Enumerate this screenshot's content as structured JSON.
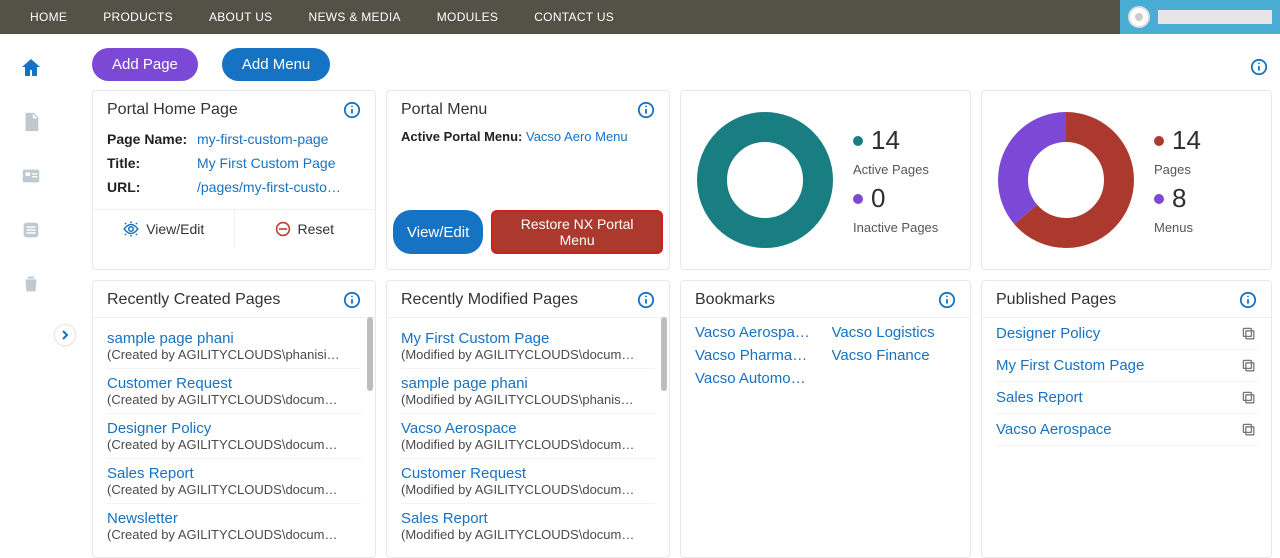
{
  "topnav": [
    "HOME",
    "PRODUCTS",
    "ABOUT US",
    "NEWS & MEDIA",
    "MODULES",
    "CONTACT US"
  ],
  "toolbar": {
    "add_page": "Add Page",
    "add_menu": "Add Menu"
  },
  "portal_home": {
    "title": "Portal Home Page",
    "labels": {
      "page_name": "Page Name:",
      "title": "Title:",
      "url": "URL:"
    },
    "values": {
      "page_name": "my-first-custom-page",
      "title": "My First Custom Page",
      "url": "/pages/my-first-custo…"
    },
    "actions": {
      "view_edit": "View/Edit",
      "reset": "Reset"
    }
  },
  "portal_menu": {
    "title": "Portal Menu",
    "active_label": "Active Portal Menu:",
    "active_value": "Vacso Aero Menu",
    "buttons": {
      "view_edit": "View/Edit",
      "restore": "Restore NX Portal Menu"
    }
  },
  "chart_data": [
    {
      "type": "pie",
      "series": [
        {
          "name": "Active Pages",
          "value": 14,
          "color": "#197e82"
        },
        {
          "name": "Inactive Pages",
          "value": 0,
          "color": "#7c48d6"
        }
      ]
    },
    {
      "type": "pie",
      "series": [
        {
          "name": "Pages",
          "value": 14,
          "color": "#ab392e"
        },
        {
          "name": "Menus",
          "value": 8,
          "color": "#7c48d6"
        }
      ]
    }
  ],
  "stats": {
    "left": [
      {
        "dot": "#197e82",
        "num": "14",
        "lab": "Active Pages"
      },
      {
        "dot": "#7c48d6",
        "num": "0",
        "lab": "Inactive Pages"
      }
    ],
    "right": [
      {
        "dot": "#ab392e",
        "num": "14",
        "lab": "Pages"
      },
      {
        "dot": "#7c48d6",
        "num": "8",
        "lab": "Menus"
      }
    ]
  },
  "recent_created": {
    "title": "Recently Created Pages",
    "items": [
      {
        "t": "sample page phani",
        "s": "(Created by AGILITYCLOUDS\\phanisi…"
      },
      {
        "t": "Customer Request",
        "s": "(Created by AGILITYCLOUDS\\docum…"
      },
      {
        "t": "Designer Policy",
        "s": "(Created by AGILITYCLOUDS\\docum…"
      },
      {
        "t": "Sales Report",
        "s": "(Created by AGILITYCLOUDS\\docum…"
      },
      {
        "t": "Newsletter",
        "s": "(Created by AGILITYCLOUDS\\docum…"
      }
    ]
  },
  "recent_modified": {
    "title": "Recently Modified Pages",
    "items": [
      {
        "t": "My First Custom Page",
        "s": "(Modified by AGILITYCLOUDS\\docum…"
      },
      {
        "t": "sample page phani",
        "s": "(Modified by AGILITYCLOUDS\\phanis…"
      },
      {
        "t": "Vacso Aerospace",
        "s": "(Modified by AGILITYCLOUDS\\docum…"
      },
      {
        "t": "Customer Request",
        "s": "(Modified by AGILITYCLOUDS\\docum…"
      },
      {
        "t": "Sales Report",
        "s": "(Modified by AGILITYCLOUDS\\docum…"
      }
    ]
  },
  "bookmarks": {
    "title": "Bookmarks",
    "items": [
      "Vacso Aerospa…",
      "Vacso Logistics",
      "Vacso Pharma…",
      "Vacso Finance",
      "Vacso Automo…"
    ]
  },
  "published": {
    "title": "Published Pages",
    "items": [
      "Designer Policy",
      "My First Custom Page",
      "Sales Report",
      "Vacso Aerospace"
    ]
  }
}
